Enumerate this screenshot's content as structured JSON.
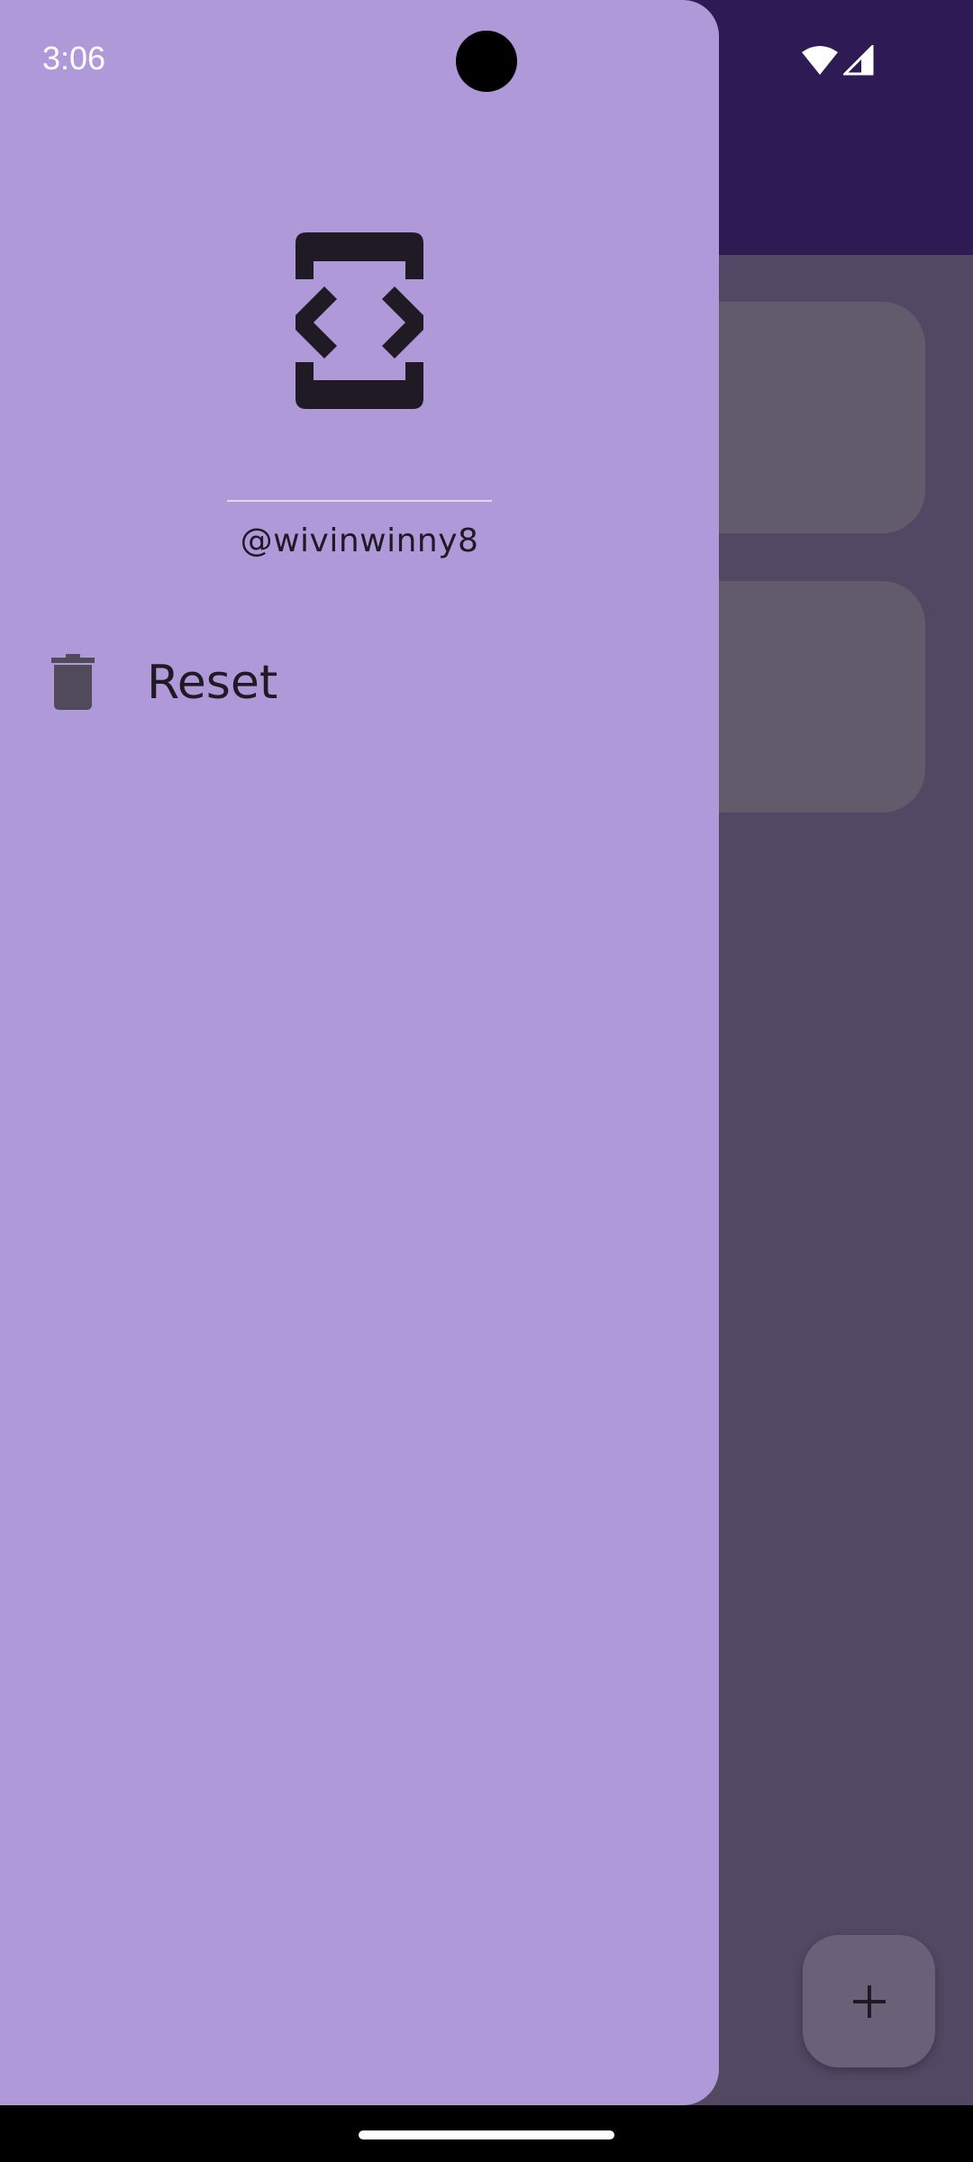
{
  "status_bar": {
    "time": "3:06",
    "icons": [
      "wifi-icon",
      "cellular-signal-icon"
    ]
  },
  "drawer": {
    "logo_icon": "code-phone-icon",
    "username": "@wivinwinny8",
    "items": [
      {
        "icon": "trash-icon",
        "label": "Reset"
      }
    ]
  },
  "background_app": {
    "fab_icon": "plus-icon"
  },
  "colors": {
    "drawer_bg": "#af99d9",
    "app_topbar": "#2f1b53",
    "scrim_bg": "#524863",
    "card_bg": "#625b6c",
    "fab_bg": "#6a6178",
    "text_dark": "#1f1a24"
  }
}
